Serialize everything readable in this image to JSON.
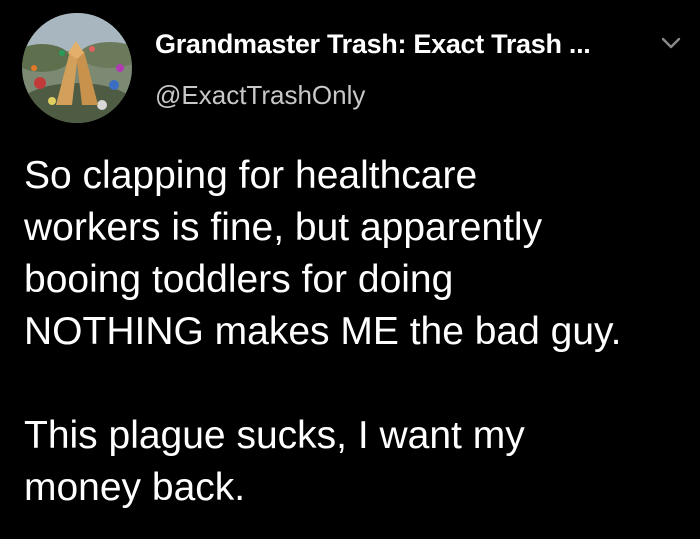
{
  "author": {
    "display_name": "Grandmaster Trash: Exact Trash ...",
    "handle": "@ExactTrashOnly",
    "avatar_icon": "landfill-hands-avatar"
  },
  "menu": {
    "icon": "chevron-down-icon"
  },
  "tweet": {
    "paragraph_1": "So clapping for healthcare\nworkers is fine, but apparently\nbooing toddlers for doing\nNOTHING makes ME the bad guy.",
    "paragraph_2": "This plague sucks, I want my\nmoney back."
  },
  "colors": {
    "background": "#000000",
    "text": "#ffffff",
    "handle_text": "#c8c8c8",
    "chevron": "#8a8a8a"
  }
}
